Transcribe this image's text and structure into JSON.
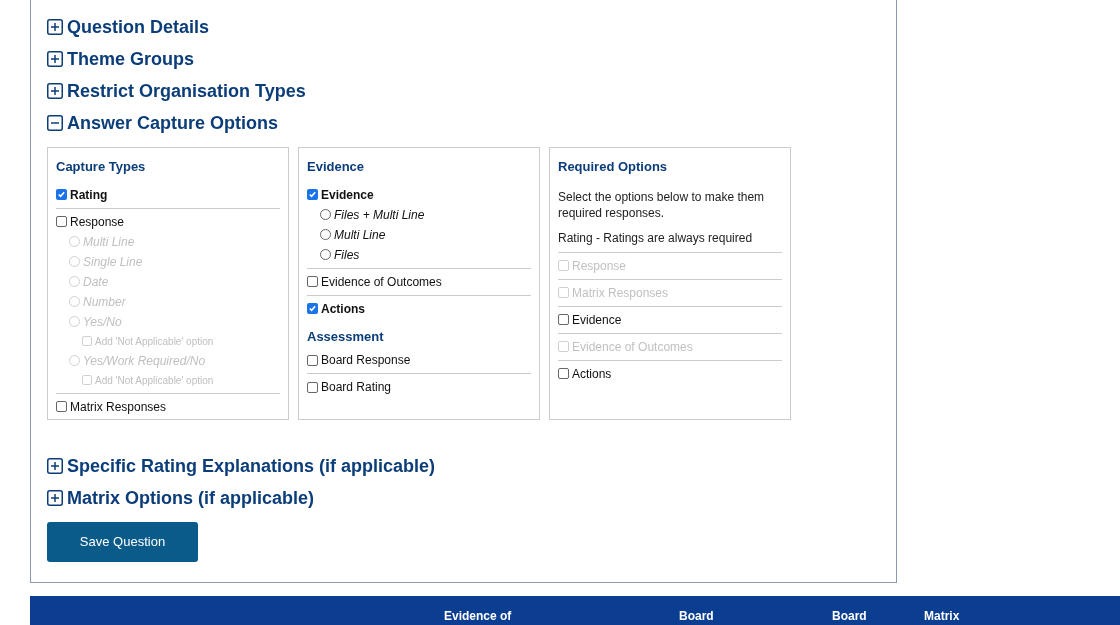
{
  "sections": [
    {
      "title": "Question Details",
      "expanded": false
    },
    {
      "title": "Theme Groups",
      "expanded": false
    },
    {
      "title": "Restrict Organisation Types",
      "expanded": false
    },
    {
      "title": "Answer Capture Options",
      "expanded": true,
      "panels": [
        {
          "title": "Capture Types",
          "items": [
            {
              "kind": "checkbox",
              "label": "Rating",
              "checked": true,
              "disabled": false
            },
            {
              "kind": "divider"
            },
            {
              "kind": "checkbox",
              "label": "Response",
              "checked": false,
              "disabled": false,
              "children": [
                {
                  "kind": "radio",
                  "label": "Multi Line",
                  "selected": false,
                  "disabled": true
                },
                {
                  "kind": "radio",
                  "label": "Single Line",
                  "selected": false,
                  "disabled": true
                },
                {
                  "kind": "radio",
                  "label": "Date",
                  "selected": false,
                  "disabled": true
                },
                {
                  "kind": "radio",
                  "label": "Number",
                  "selected": false,
                  "disabled": true
                },
                {
                  "kind": "radio",
                  "label": "Yes/No",
                  "selected": false,
                  "disabled": true,
                  "children": [
                    {
                      "kind": "checkbox",
                      "label": "Add 'Not Applicable' option",
                      "checked": false,
                      "disabled": true
                    }
                  ]
                },
                {
                  "kind": "radio",
                  "label": "Yes/Work Required/No",
                  "selected": false,
                  "disabled": true,
                  "children": [
                    {
                      "kind": "checkbox",
                      "label": "Add 'Not Applicable' option",
                      "checked": false,
                      "disabled": true
                    }
                  ]
                }
              ]
            },
            {
              "kind": "divider"
            },
            {
              "kind": "checkbox",
              "label": "Matrix Responses",
              "checked": false,
              "disabled": false
            }
          ]
        },
        {
          "title": "Evidence",
          "items": [
            {
              "kind": "checkbox",
              "label": "Evidence",
              "checked": true,
              "disabled": false,
              "children": [
                {
                  "kind": "radio",
                  "label": "Files + Multi Line",
                  "selected": false,
                  "disabled": false
                },
                {
                  "kind": "radio",
                  "label": "Multi Line",
                  "selected": false,
                  "disabled": false
                },
                {
                  "kind": "radio",
                  "label": "Files",
                  "selected": false,
                  "disabled": false
                }
              ]
            },
            {
              "kind": "divider"
            },
            {
              "kind": "checkbox",
              "label": "Evidence of Outcomes",
              "checked": false,
              "disabled": false
            },
            {
              "kind": "divider"
            },
            {
              "kind": "checkbox",
              "label": "Actions",
              "checked": true,
              "disabled": false
            },
            {
              "kind": "heading",
              "label": "Assessment"
            },
            {
              "kind": "checkbox",
              "label": "Board Response",
              "checked": false,
              "disabled": false
            },
            {
              "kind": "divider"
            },
            {
              "kind": "checkbox",
              "label": "Board Rating",
              "checked": false,
              "disabled": false
            }
          ]
        },
        {
          "title": "Required Options",
          "items": [
            {
              "kind": "text",
              "label": "Select the options below to make them required responses."
            },
            {
              "kind": "text",
              "label": "Rating - Ratings are always required"
            },
            {
              "kind": "divider"
            },
            {
              "kind": "checkbox",
              "label": "Response",
              "checked": false,
              "disabled": true
            },
            {
              "kind": "divider"
            },
            {
              "kind": "checkbox",
              "label": "Matrix Responses",
              "checked": false,
              "disabled": true
            },
            {
              "kind": "divider"
            },
            {
              "kind": "checkbox",
              "label": "Evidence",
              "checked": false,
              "disabled": false
            },
            {
              "kind": "divider"
            },
            {
              "kind": "checkbox",
              "label": "Evidence of Outcomes",
              "checked": false,
              "disabled": true
            },
            {
              "kind": "divider"
            },
            {
              "kind": "checkbox",
              "label": "Actions",
              "checked": false,
              "disabled": false
            }
          ]
        }
      ]
    },
    {
      "title": "Specific Rating Explanations (if applicable)",
      "expanded": false
    },
    {
      "title": "Matrix Options (if applicable)",
      "expanded": false
    }
  ],
  "save_button": "Save Question",
  "table": {
    "columns": [
      "Evidence of",
      "Board",
      "Board",
      "Matrix"
    ]
  }
}
